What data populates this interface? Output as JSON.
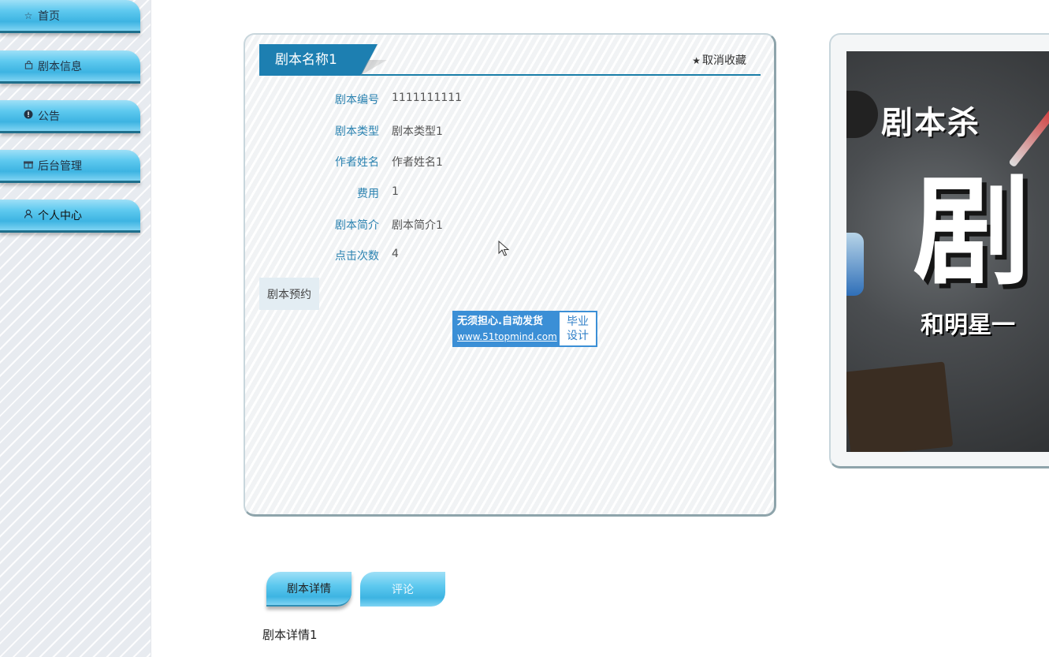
{
  "sidebar": {
    "items": [
      {
        "label": "首页",
        "icon": "star-icon"
      },
      {
        "label": "剧本信息",
        "icon": "bag-icon"
      },
      {
        "label": "公告",
        "icon": "alert-icon"
      },
      {
        "label": "后台管理",
        "icon": "gift-icon"
      },
      {
        "label": "个人中心",
        "icon": "user-icon"
      }
    ],
    "active_index": 4
  },
  "detail": {
    "title": "剧本名称1",
    "favorite_label": "取消收藏",
    "fields": [
      {
        "label": "剧本编号",
        "value": "1111111111"
      },
      {
        "label": "剧本类型",
        "value": "剧本类型1"
      },
      {
        "label": "作者姓名",
        "value": "作者姓名1"
      },
      {
        "label": "费用",
        "value": "1"
      },
      {
        "label": "剧本简介",
        "value": "剧本简介1"
      },
      {
        "label": "点击次数",
        "value": "4"
      }
    ],
    "reserve_label": "剧本预约"
  },
  "ad": {
    "line1": "无须担心.自动发货",
    "line2": "www.51topmind.com",
    "right_top": "毕业",
    "right_bottom": "设计"
  },
  "poster": {
    "title": "剧本杀",
    "big_char": "剧",
    "subtitle": "和明星一"
  },
  "tabs": [
    {
      "label": "剧本详情"
    },
    {
      "label": "评论"
    }
  ],
  "content": {
    "detail_text": "剧本详情1"
  },
  "colors": {
    "accent": "#1d7fb1",
    "label_blue": "#2a82b0",
    "nav_gradient": "#5ec9ef"
  }
}
